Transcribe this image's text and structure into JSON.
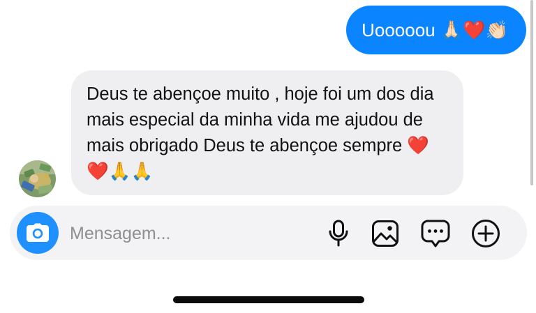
{
  "thread": {
    "outgoing": {
      "text": "Uooooou 🙏🏻❤️👏🏻"
    },
    "incoming": {
      "text": "Deus te abençoe muito , hoje foi um dos dia mais especial da minha vida me ajudou de mais obrigado Deus te abençoe sempre ❤️❤️🙏🙏"
    }
  },
  "composer": {
    "placeholder": "Mensagem...",
    "icons": [
      "camera-icon",
      "microphone-icon",
      "gallery-icon",
      "sticker-chat-icon",
      "add-icon"
    ]
  },
  "colors": {
    "outgoing_bubble": "#0a84ff",
    "incoming_bubble": "#efeff1",
    "camera_button": "#1e90ff",
    "composer_background": "#f3f3f5"
  }
}
